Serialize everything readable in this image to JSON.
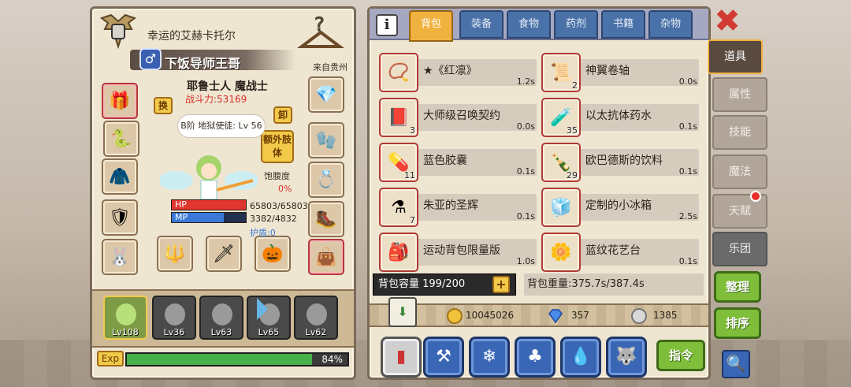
{
  "character": {
    "guild_title": "幸运的艾赫卡托尔",
    "gender_symbol": "♂",
    "name": "下饭导师王哥",
    "origin": "来自贵州",
    "race_class": "耶鲁士人 魔战士",
    "power": "战斗力:53169",
    "pet_status": "B阶 地狱使徒: Lv 56",
    "swap_label": "换",
    "unequip_label": "卸",
    "extra_limb_label": "额外肢体",
    "satiety_label": "饱腹度",
    "satiety_value": "0%",
    "hp_label": "HP",
    "mp_label": "MP",
    "hp_value": "65803/65803",
    "mp_value": "3382/4832",
    "mp_fraction": 0.7,
    "shield_value": "护盾:0"
  },
  "team": [
    {
      "level": "Lv108"
    },
    {
      "level": "Lv36"
    },
    {
      "level": "Lv63"
    },
    {
      "level": "Lv65"
    },
    {
      "level": "Lv62"
    }
  ],
  "exp": {
    "label": "Exp",
    "percent": "84%",
    "fraction": 0.84
  },
  "bag_tabs": [
    "背包",
    "装备",
    "食物",
    "药剂",
    "书籍",
    "杂物"
  ],
  "items": [
    {
      "name": "★《红凛》",
      "weight": "1.2s",
      "count": "",
      "icon": "collar-icon"
    },
    {
      "name": "神翼卷轴",
      "weight": "0.0s",
      "count": "2",
      "icon": "scroll-icon"
    },
    {
      "name": "大师级召唤契约",
      "weight": "0.0s",
      "count": "3",
      "icon": "contract-icon"
    },
    {
      "name": "以太抗体药水",
      "weight": "0.1s",
      "count": "35",
      "icon": "potion-icon"
    },
    {
      "name": "蓝色胶囊",
      "weight": "0.1s",
      "count": "11",
      "icon": "capsule-icon"
    },
    {
      "name": "欧巴德斯的饮料",
      "weight": "0.1s",
      "count": "29",
      "icon": "bottle-icon"
    },
    {
      "name": "朱亚的圣辉",
      "weight": "0.1s",
      "count": "7",
      "icon": "flask-icon"
    },
    {
      "name": "定制的小冰箱",
      "weight": "2.5s",
      "count": "",
      "icon": "fridge-icon"
    },
    {
      "name": "运动背包限量版",
      "weight": "1.0s",
      "count": "",
      "icon": "backpack-icon"
    },
    {
      "name": "蓝纹花艺台",
      "weight": "0.1s",
      "count": "",
      "icon": "flower-stand-icon"
    }
  ],
  "bag": {
    "capacity": "背包容量 199/200",
    "plus_label": "+",
    "weight": "背包重量:375.7s/387.4s"
  },
  "currency": {
    "gold": "10045026",
    "gems": "357",
    "silver": "1385"
  },
  "command_label": "指令",
  "side_menu": [
    "道具",
    "属性",
    "技能",
    "魔法",
    "天赋",
    "乐团"
  ],
  "organize_label": "整理",
  "sort_label": "排序",
  "colors": {
    "active_tab": "#f0b23e",
    "tab": "#4a72a8",
    "hp": "#e13530",
    "mp": "#3a79d8",
    "exp": "#48b04a",
    "green_button": "#7fbe3a"
  }
}
